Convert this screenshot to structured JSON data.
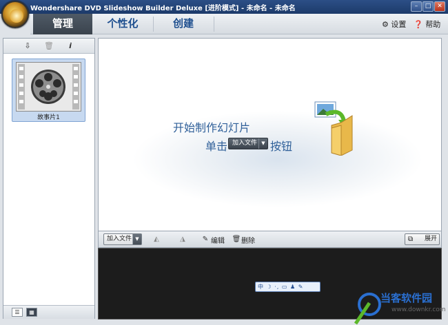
{
  "window": {
    "title": "Wondershare DVD Slideshow Builder Deluxe [进阶模式] - 未命名 - 未命名",
    "controls": {
      "minimize": "–",
      "maximize": "□",
      "close": "✕"
    }
  },
  "nav": {
    "tabs": [
      {
        "label": "管理",
        "active": true
      },
      {
        "label": "个性化",
        "active": false
      },
      {
        "label": "创建",
        "active": false
      }
    ],
    "settings_label": "设置",
    "help_label": "帮助"
  },
  "sidebar": {
    "tools": {
      "import_icon": "⇩",
      "delete_icon": "🗑",
      "info_icon": "i"
    },
    "items": [
      {
        "label": "故事片1",
        "icon": "film-reel-icon"
      }
    ],
    "view_buttons": {
      "list": "☰",
      "grid": "▦"
    }
  },
  "main": {
    "prompt_title": "开始制作幻灯片",
    "prompt_prefix": "单击",
    "inline_button_label": "加入文件",
    "dropdown_arrow": "▼",
    "prompt_suffix": "按钮"
  },
  "bottom_toolbar": {
    "add_file_label": "加入文件",
    "dropdown_arrow": "▼",
    "rotate_left_icon": "◭",
    "rotate_right_icon": "◮",
    "edit_icon": "✎",
    "edit_label": "编辑",
    "delete_icon": "🗑",
    "delete_label": "删除",
    "expand_label": "展开"
  },
  "ime_bar": {
    "text": "中 ☽ ·, ▭ ♟ ✎"
  },
  "watermark": {
    "text": "当客软件园",
    "url": "www.downkr.com"
  },
  "colors": {
    "accent": "#1e4f8f",
    "prompt": "#2f5f99",
    "titlebar": "#2c4f86"
  }
}
